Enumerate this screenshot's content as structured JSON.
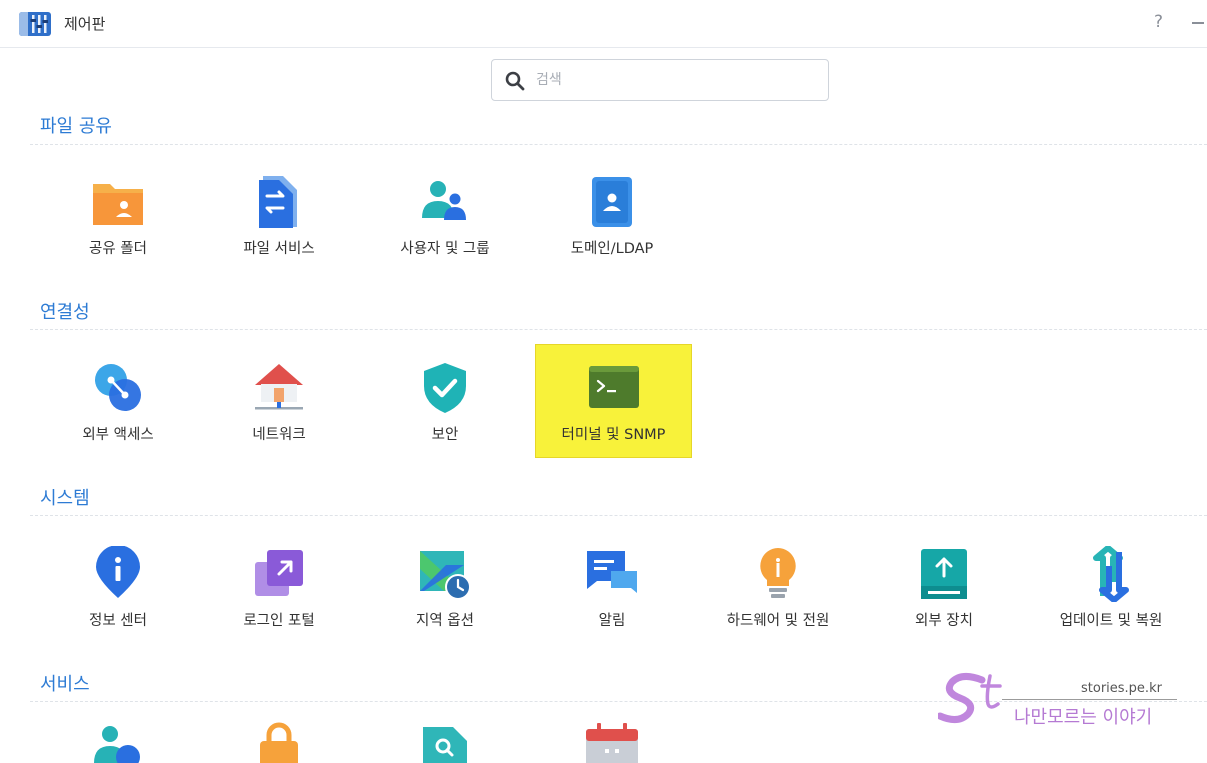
{
  "window": {
    "title": "제어판",
    "help_label": "?",
    "accent": "#2d7bd4",
    "icon": "control-panel-icon"
  },
  "search": {
    "placeholder": "검색",
    "value": ""
  },
  "sections": [
    {
      "title": "파일 공유",
      "items": [
        {
          "label": "공유 폴더",
          "icon": "shared-folder-icon"
        },
        {
          "label": "파일 서비스",
          "icon": "file-services-icon"
        },
        {
          "label": "사용자 및 그룹",
          "icon": "user-group-icon"
        },
        {
          "label": "도메인/LDAP",
          "icon": "domain-ldap-icon"
        }
      ]
    },
    {
      "title": "연결성",
      "items": [
        {
          "label": "외부 액세스",
          "icon": "external-access-icon"
        },
        {
          "label": "네트워크",
          "icon": "network-icon"
        },
        {
          "label": "보안",
          "icon": "security-shield-icon"
        },
        {
          "label": "터미널 및 SNMP",
          "icon": "terminal-icon",
          "highlighted": true
        }
      ]
    },
    {
      "title": "시스템",
      "items": [
        {
          "label": "정보 센터",
          "icon": "info-center-icon"
        },
        {
          "label": "로그인 포털",
          "icon": "login-portal-icon"
        },
        {
          "label": "지역 옵션",
          "icon": "regional-options-icon"
        },
        {
          "label": "알림",
          "icon": "notification-icon"
        },
        {
          "label": "하드웨어 및 전원",
          "icon": "hardware-power-icon"
        },
        {
          "label": "외부 장치",
          "icon": "external-devices-icon"
        },
        {
          "label": "업데이트 및 복원",
          "icon": "update-restore-icon"
        }
      ]
    },
    {
      "title": "서비스",
      "items": [
        {
          "icon": "user-account-icon"
        },
        {
          "icon": "privileges-lock-icon"
        },
        {
          "icon": "indexing-service-icon"
        },
        {
          "icon": "task-scheduler-icon"
        }
      ]
    }
  ],
  "watermark": {
    "url": "stories.pe.kr",
    "tagline": "나만모르는 이야기"
  }
}
